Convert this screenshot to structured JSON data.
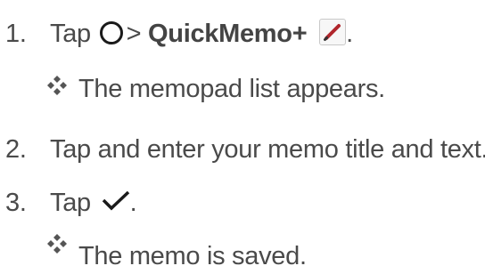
{
  "steps": [
    {
      "number": "1.",
      "before": "Tap",
      "middle": "> ",
      "bold": "QuickMemo+",
      "after": "."
    },
    {
      "number": "2.",
      "text": "Tap and enter your memo title and text."
    },
    {
      "number": "3.",
      "before": "Tap",
      "after": "."
    }
  ],
  "results": [
    {
      "text": "The memopad list appears."
    },
    {
      "text": "The memo is saved."
    }
  ],
  "icons": {
    "home": "circle-home-icon",
    "app": "pencil-icon",
    "confirm": "checkmark-icon",
    "bullet": "four-diamond-bullet-icon"
  },
  "colors": {
    "text": "#4a4a4a",
    "bullet": "#555555",
    "pencil": "#b0262c"
  }
}
